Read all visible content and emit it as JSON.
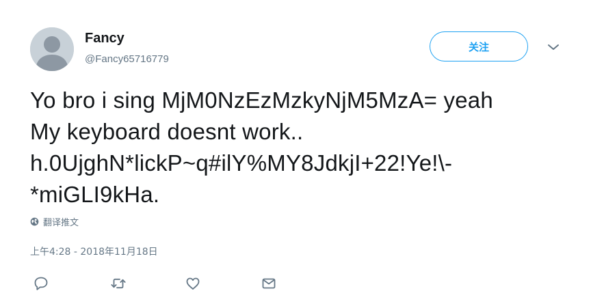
{
  "user": {
    "display_name": "Fancy",
    "handle": "@Fancy65716779"
  },
  "follow_button": {
    "label": "关注"
  },
  "tweet": {
    "lines": [
      "Yo bro i sing MjM0NzEzMzkyNjM5MzA= yeah",
      "My keyboard doesnt work..",
      "h.0UjghN*lickP~q#ilY%MY8JdkjI+22!Ye!\\-",
      "*miGLI9kHa."
    ]
  },
  "translate_link": "翻译推文",
  "timestamp": "上午4:28 - 2018年11月18日",
  "colors": {
    "accent": "#1da1f2",
    "secondary_text": "#657786",
    "primary_text": "#14171a"
  },
  "icons": {
    "reply": "reply-icon",
    "retweet": "retweet-icon",
    "like": "heart-icon",
    "message": "envelope-icon",
    "more": "chevron-down-icon",
    "translate": "globe-icon"
  }
}
